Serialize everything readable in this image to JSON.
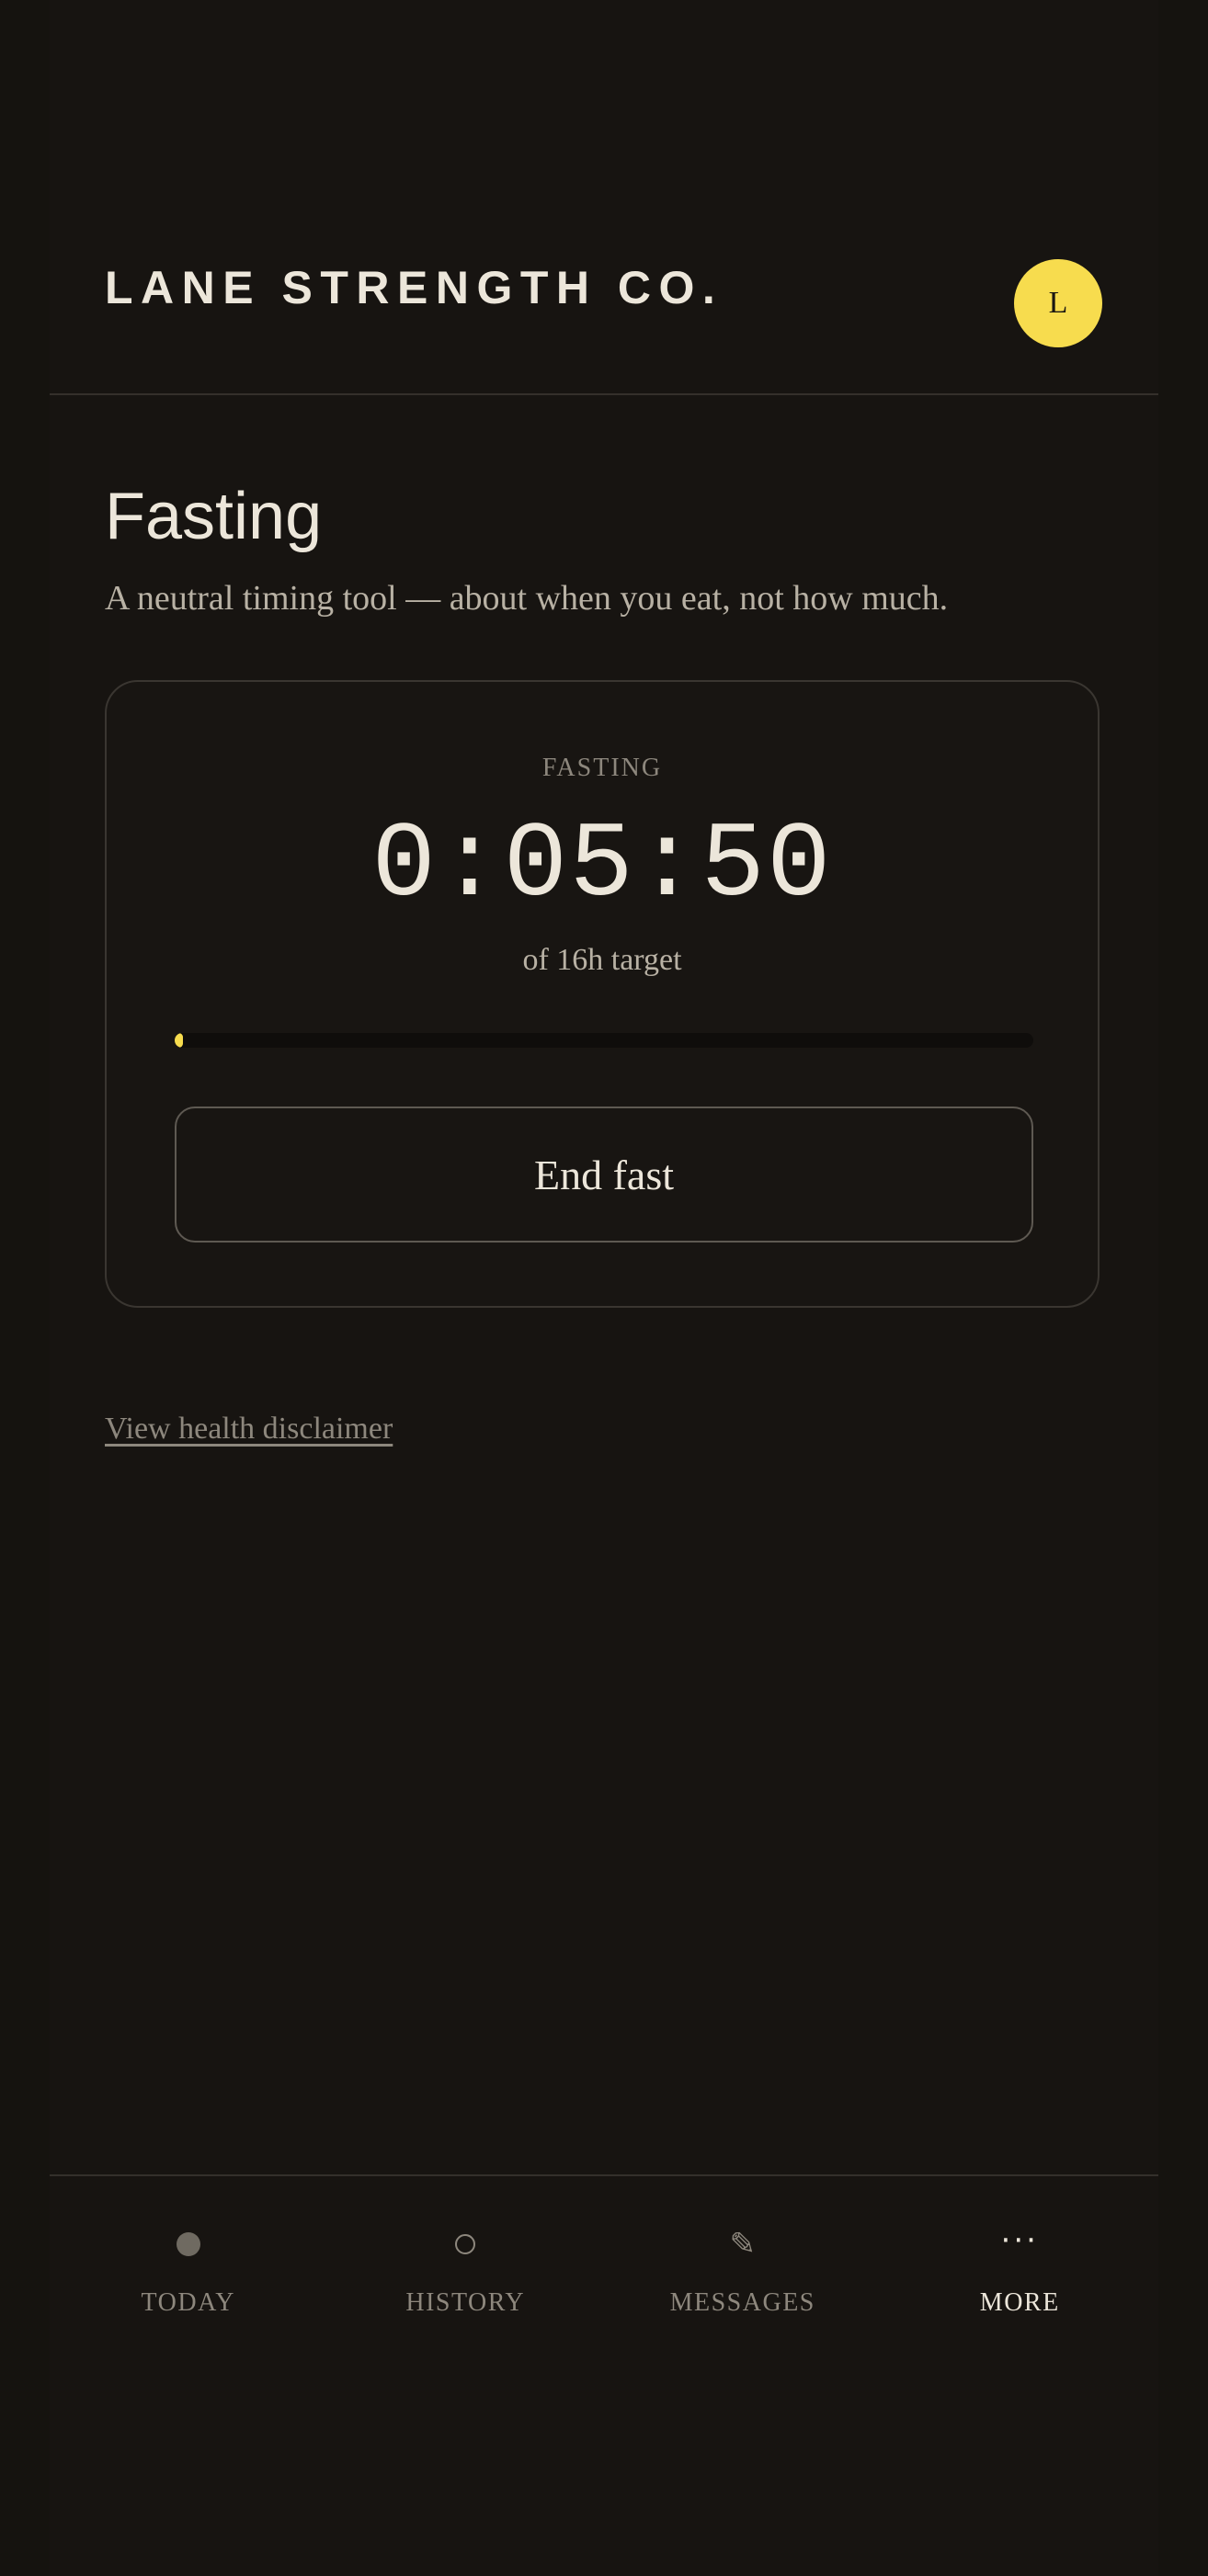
{
  "header": {
    "brand": "LANE STRENGTH CO.",
    "avatar_initial": "L",
    "avatar_color": "#f7dc4e"
  },
  "page": {
    "title": "Fasting",
    "subtitle": "A neutral timing tool — about when you eat, not how much."
  },
  "fast_card": {
    "state_label": "FASTING",
    "elapsed": "0:05:50",
    "target_text": "of 16h target",
    "progress_fraction": 0.006,
    "progress_color": "#f7dc4e",
    "end_button_label": "End fast"
  },
  "links": {
    "disclaimer": "View health disclaimer"
  },
  "bottom_nav": {
    "items": [
      {
        "label": "TODAY",
        "icon": "filled-dot-icon",
        "active": false
      },
      {
        "label": "HISTORY",
        "icon": "circle-icon",
        "active": false
      },
      {
        "label": "MESSAGES",
        "icon": "pencil-icon",
        "active": false
      },
      {
        "label": "MORE",
        "icon": "more-dots-icon",
        "active": true
      }
    ]
  },
  "colors": {
    "background": "#171411",
    "text": "#ece6da",
    "muted": "#8d877d",
    "accent": "#f7dc4e"
  }
}
